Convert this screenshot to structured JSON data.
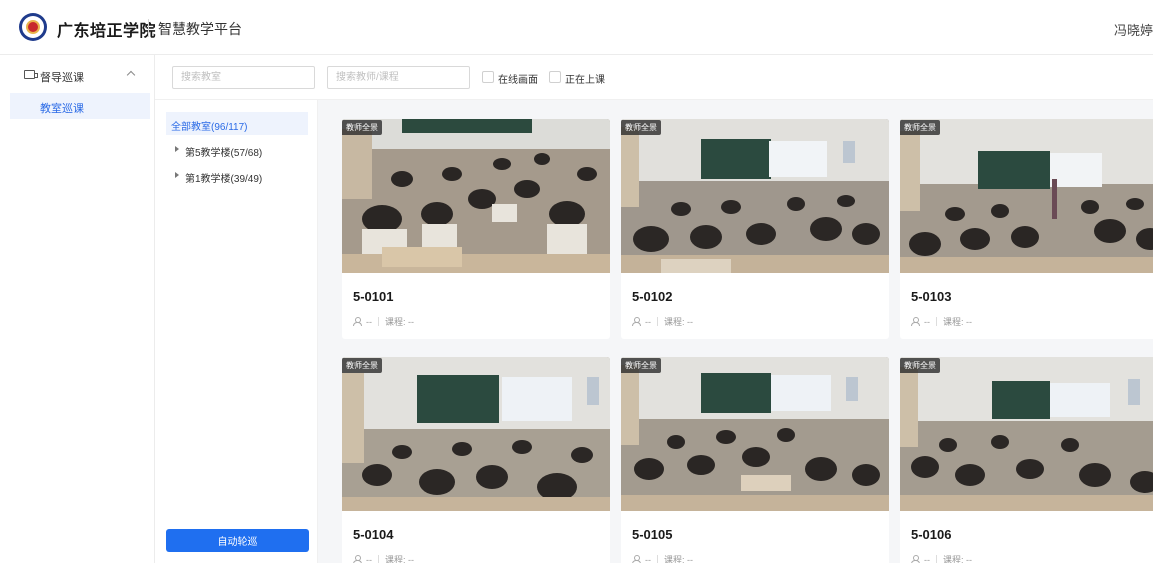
{
  "header": {
    "school_name": "广东培正学院",
    "platform_name": "智慧教学平台",
    "user_name": "冯晓婷"
  },
  "nav": {
    "group_label": "督导巡课",
    "active_item": "教室巡课"
  },
  "filters": {
    "classroom_placeholder": "搜索教室",
    "teacher_placeholder": "搜索教师/课程",
    "online_label": "在线画面",
    "in_class_label": "正在上课"
  },
  "tree": {
    "all_label": "全部教室(96/117)",
    "nodes": [
      {
        "label": "第5教学楼(57/68)"
      },
      {
        "label": "第1教学楼(39/49)"
      }
    ],
    "auto_button": "自动轮巡"
  },
  "cards": [
    {
      "tag": "教师全景",
      "room": "5-0101",
      "teacher": "--",
      "course": "课程: --"
    },
    {
      "tag": "教师全景",
      "room": "5-0102",
      "teacher": "--",
      "course": "课程: --"
    },
    {
      "tag": "教师全景",
      "room": "5-0103",
      "teacher": "--",
      "course": "课程: --"
    },
    {
      "tag": "教师全景",
      "room": "5-0104",
      "teacher": "--",
      "course": "课程: --"
    },
    {
      "tag": "教师全景",
      "room": "5-0105",
      "teacher": "--",
      "course": "课程: --"
    },
    {
      "tag": "教师全景",
      "room": "5-0106",
      "teacher": "--",
      "course": "课程: --"
    }
  ],
  "colors": {
    "accent": "#1f6ff0",
    "active_bg": "#eef3fd",
    "grid_bg": "#f5f6f8"
  }
}
